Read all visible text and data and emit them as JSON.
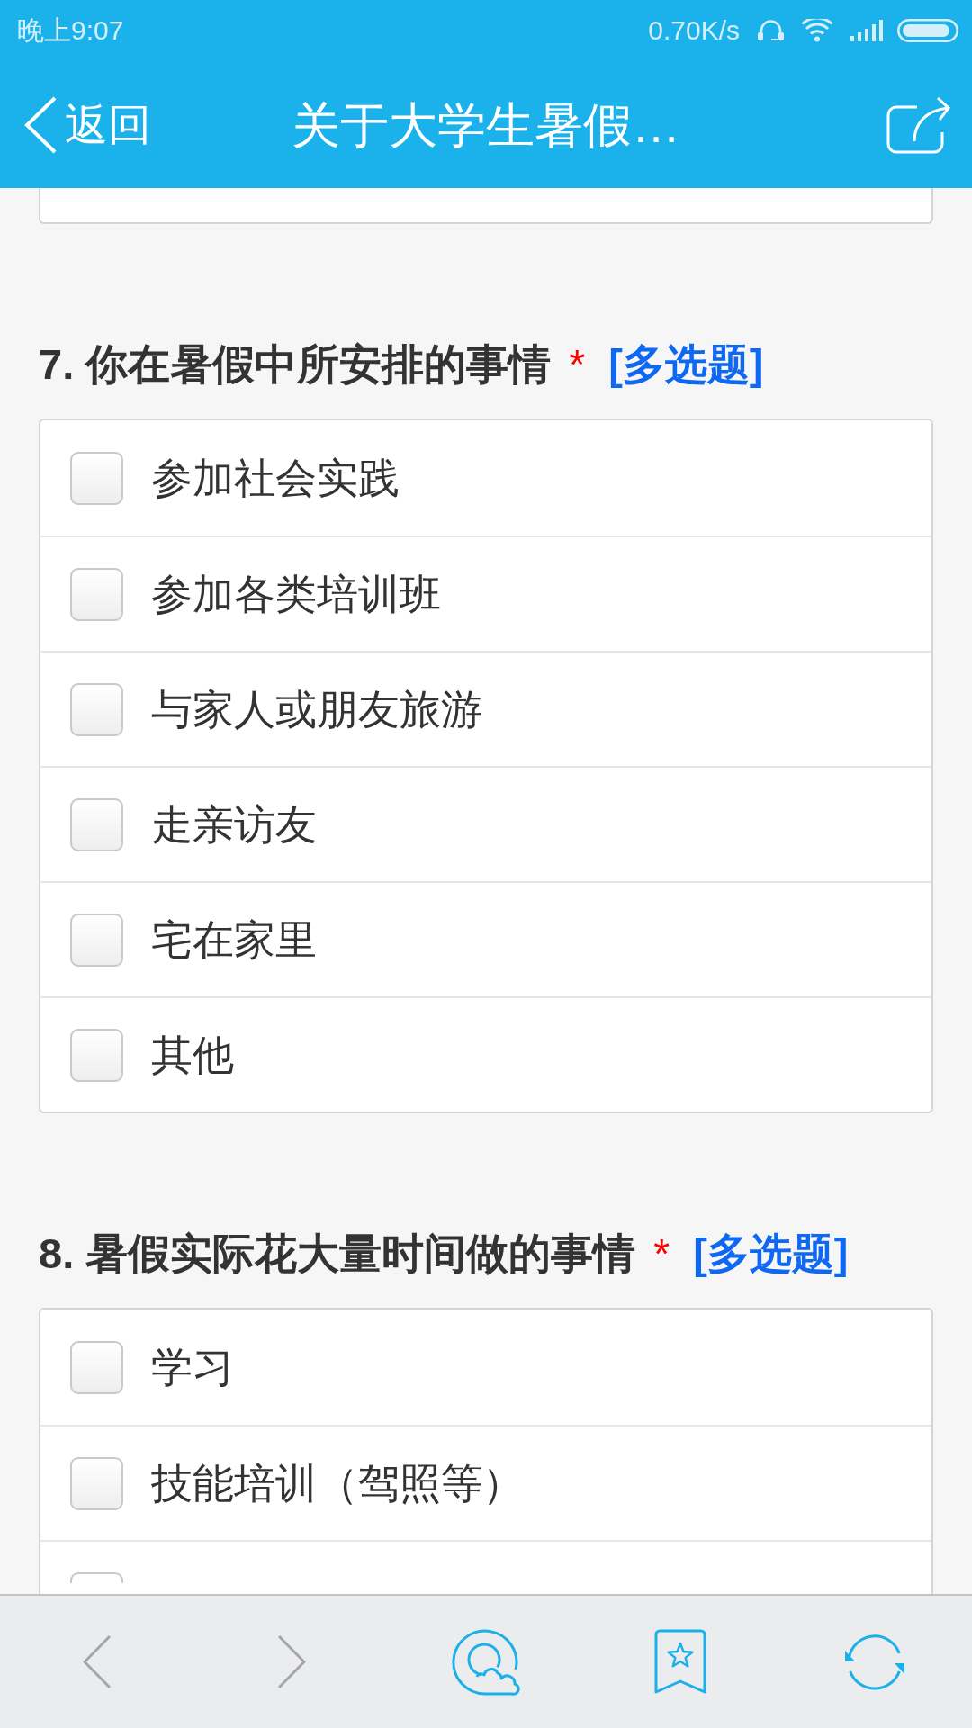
{
  "status_bar": {
    "time": "晚上9:07",
    "network_speed": "0.70K/s"
  },
  "nav_bar": {
    "back_label": "返回",
    "title": "关于大学生暑假…"
  },
  "questions": [
    {
      "title": "7. 你在暑假中所安排的事情",
      "required_mark": "*",
      "type_tag": "[多选题]",
      "options": [
        {
          "label": "参加社会实践",
          "checked": false
        },
        {
          "label": "参加各类培训班",
          "checked": false
        },
        {
          "label": "与家人或朋友旅游",
          "checked": false
        },
        {
          "label": "走亲访友",
          "checked": false
        },
        {
          "label": "宅在家里",
          "checked": false
        },
        {
          "label": "其他",
          "checked": false
        }
      ]
    },
    {
      "title": "8. 暑假实际花大量时间做的事情",
      "required_mark": "*",
      "type_tag": "[多选题]",
      "options": [
        {
          "label": "学习",
          "checked": false
        },
        {
          "label": "技能培训（驾照等）",
          "checked": false
        },
        {
          "checked": false
        }
      ]
    }
  ],
  "toolbar": [
    {
      "kind": "back",
      "disabled": true
    },
    {
      "kind": "forward",
      "disabled": true
    },
    {
      "kind": "cloud",
      "disabled": false
    },
    {
      "kind": "bookmark",
      "disabled": false
    },
    {
      "kind": "refresh",
      "disabled": false
    }
  ]
}
